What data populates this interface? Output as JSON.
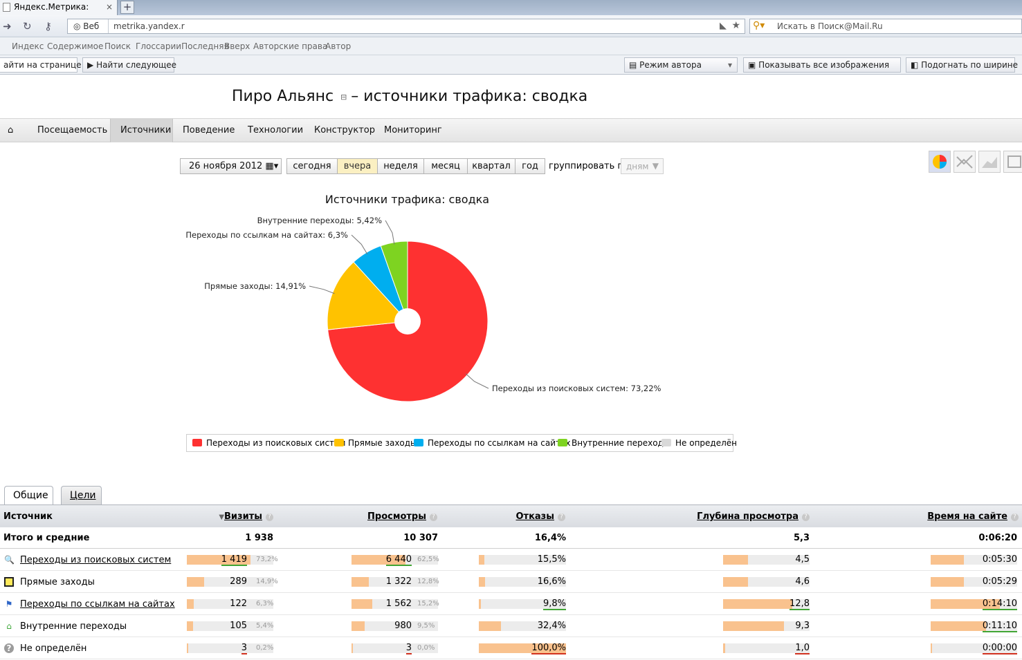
{
  "browser": {
    "tab_title": "Яндекс.Метрика:",
    "tab_close": "×",
    "new_tab": "+",
    "address_prefix": "Веб",
    "address_url": "metrika.yandex.r",
    "search_placeholder": "Искать в Поиск@Mail.Ru",
    "bookmarks": [
      "Индекс",
      "Содержимое",
      "Поиск",
      "ГлоссарииПоследняя",
      "Вверх",
      "Авторские права",
      "Автор"
    ],
    "find_on_page": "айти на странице",
    "find_next": "Найти следующее",
    "author_mode": "Режим автора",
    "show_images": "Показывать все изображения",
    "fit_width": "Подогнать по ширине"
  },
  "page": {
    "title_site": "Пиро Альянс",
    "title_rest": "– источники трафика: сводка"
  },
  "menu": {
    "items": [
      "Посещаемость",
      "Источники",
      "Поведение",
      "Технологии",
      "Конструктор",
      "Мониторинг"
    ],
    "active": "Источники"
  },
  "period": {
    "date": "26 ноября 2012",
    "buttons": [
      "сегодня",
      "вчера",
      "неделя",
      "месяц",
      "квартал",
      "год"
    ],
    "active": "вчера",
    "group_label": "группировать по",
    "group_value": "дням"
  },
  "colors": {
    "search": "#fe3131",
    "direct": "#ffc200",
    "links": "#00aeef",
    "internal": "#7ed321",
    "undefined": "#d9d9d9",
    "bar": "#f9c28e",
    "good": "#41a535",
    "bad": "#d2311f"
  },
  "chart_data": {
    "type": "pie",
    "title": "Источники трафика: сводка",
    "slices": [
      {
        "label": "Переходы из поисковых систем",
        "value": 73.22,
        "display": "Переходы из поисковых систем: 73,22%",
        "color": "#fe3131"
      },
      {
        "label": "Прямые заходы",
        "value": 14.91,
        "display": "Прямые заходы: 14,91%",
        "color": "#ffc200"
      },
      {
        "label": "Переходы по ссылкам на сайтах",
        "value": 6.3,
        "display": "Переходы по ссылкам на сайтах: 6,3%",
        "color": "#00aeef"
      },
      {
        "label": "Внутренние переходы",
        "value": 5.42,
        "display": "Внутренние переходы: 5,42%",
        "color": "#7ed321"
      }
    ],
    "legend": [
      {
        "label": "Переходы из поисковых систем",
        "color": "#fe3131"
      },
      {
        "label": "Прямые заходы",
        "color": "#ffc200"
      },
      {
        "label": "Переходы по ссылкам на сайтах",
        "color": "#00aeef"
      },
      {
        "label": "Внутренние переходы",
        "color": "#7ed321"
      },
      {
        "label": "Не определён",
        "color": "#d9d9d9"
      }
    ],
    "legend_position": "bottom"
  },
  "tabs": {
    "general": "Общие",
    "goals": "Цели"
  },
  "table": {
    "headers": {
      "source": "Источник",
      "visits": "Визиты",
      "views": "Просмотры",
      "bounces": "Отказы",
      "depth": "Глубина просмотра",
      "time": "Время на сайте",
      "help": "?"
    },
    "totals": {
      "label": "Итого и средние",
      "visits": "1 938",
      "views": "10 307",
      "bounces": "16,4%",
      "depth": "5,3",
      "time": "0:06:20"
    },
    "rows": [
      {
        "icon": "search-icon",
        "glyph": "🔍",
        "label": "Переходы из поисковых систем",
        "link": true,
        "visits": "1 419",
        "visits_pct": "73,2%",
        "visits_frac": 0.732,
        "visits_mark": "good",
        "views": "6 440",
        "views_pct": "62,5%",
        "views_frac": 0.625,
        "views_mark": "good",
        "bounces": "15,5%",
        "bounces_frac": 0.06,
        "bounces_mark": "",
        "depth": "4,5",
        "depth_frac": 0.29,
        "depth_mark": "",
        "time": "0:05:30",
        "time_frac": 0.38,
        "time_mark": ""
      },
      {
        "icon": "direct-icon",
        "glyph": "▣",
        "label": "Прямые заходы",
        "link": false,
        "visits": "289",
        "visits_pct": "14,9%",
        "visits_frac": 0.2,
        "visits_mark": "",
        "views": "1 322",
        "views_pct": "12,8%",
        "views_frac": 0.2,
        "views_mark": "",
        "bounces": "16,6%",
        "bounces_frac": 0.07,
        "bounces_mark": "",
        "depth": "4,6",
        "depth_frac": 0.29,
        "depth_mark": "",
        "time": "0:05:29",
        "time_frac": 0.38,
        "time_mark": ""
      },
      {
        "icon": "links-icon",
        "glyph": "⚑",
        "label": "Переходы по ссылкам на сайтах",
        "link": true,
        "visits": "122",
        "visits_pct": "6,3%",
        "visits_frac": 0.08,
        "visits_mark": "",
        "views": "1 562",
        "views_pct": "15,2%",
        "views_frac": 0.24,
        "views_mark": "",
        "bounces": "9,8%",
        "bounces_frac": 0.02,
        "bounces_mark": "good",
        "depth": "12,8",
        "depth_frac": 0.8,
        "depth_mark": "good",
        "time": "0:14:10",
        "time_frac": 0.8,
        "time_mark": "good"
      },
      {
        "icon": "internal-icon",
        "glyph": "⌂",
        "label": "Внутренние переходы",
        "link": false,
        "visits": "105",
        "visits_pct": "5,4%",
        "visits_frac": 0.07,
        "visits_mark": "",
        "views": "980",
        "views_pct": "9,5%",
        "views_frac": 0.15,
        "views_mark": "",
        "bounces": "32,4%",
        "bounces_frac": 0.25,
        "bounces_mark": "",
        "depth": "9,3",
        "depth_frac": 0.7,
        "depth_mark": "",
        "time": "0:11:10",
        "time_frac": 0.64,
        "time_mark": "good"
      },
      {
        "icon": "undefined-icon",
        "glyph": "?",
        "label": "Не определён",
        "link": false,
        "visits": "3",
        "visits_pct": "0,2%",
        "visits_frac": 0.01,
        "visits_mark": "bad",
        "views": "3",
        "views_pct": "0,0%",
        "views_frac": 0.01,
        "views_mark": "bad",
        "bounces": "100,0%",
        "bounces_frac": 1.0,
        "bounces_mark": "bad",
        "depth": "1,0",
        "depth_frac": 0.02,
        "depth_mark": "bad",
        "time": "0:00:00",
        "time_frac": 0.01,
        "time_mark": "bad"
      }
    ]
  }
}
